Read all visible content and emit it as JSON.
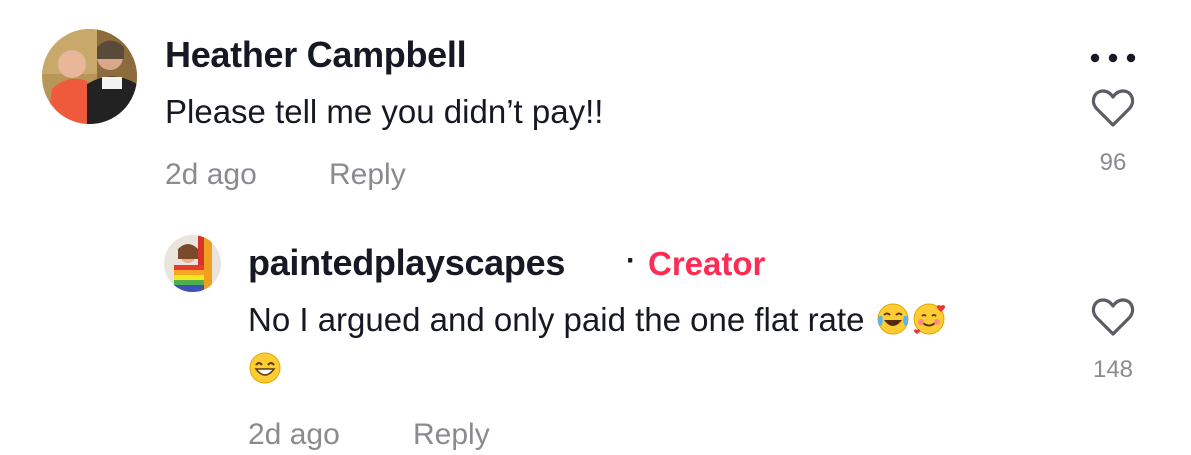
{
  "comment": {
    "author": "Heather Campbell",
    "text": "Please tell me you didn’t pay!!",
    "timestamp": "2d ago",
    "reply_label": "Reply",
    "like_count": "96",
    "more_icon": "more-options-icon",
    "like_icon": "heart-outline-icon"
  },
  "reply": {
    "author": "paintedplayscapes",
    "separator": "·",
    "badge": "Creator",
    "text": "No I argued and only paid the one flat rate",
    "emojis_inline": [
      "face-with-tears-of-joy",
      "smiling-face-with-hearts"
    ],
    "emoji_line2": "beaming-face-with-smiling-eyes",
    "timestamp": "2d ago",
    "reply_label": "Reply",
    "like_count": "148",
    "like_icon": "heart-outline-icon"
  },
  "colors": {
    "text": "#161823",
    "muted": "#8a8b91",
    "creator": "#fe2c55"
  }
}
